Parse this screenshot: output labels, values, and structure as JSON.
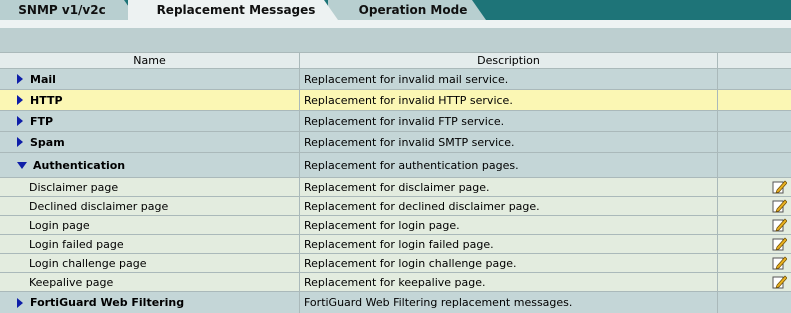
{
  "tabs": [
    {
      "label": "SNMP v1/v2c"
    },
    {
      "label": "Replacement Messages"
    },
    {
      "label": "Operation Mode"
    }
  ],
  "table": {
    "headers": {
      "name": "Name",
      "description": "Description"
    },
    "rows": [
      {
        "name": "Mail",
        "description": "Replacement for invalid mail service."
      },
      {
        "name": "HTTP",
        "description": "Replacement for invalid HTTP service."
      },
      {
        "name": "FTP",
        "description": "Replacement for invalid FTP service."
      },
      {
        "name": "Spam",
        "description": "Replacement for invalid SMTP service."
      },
      {
        "name": "Authentication",
        "description": "Replacement for authentication pages."
      },
      {
        "name": "Disclaimer page",
        "description": "Replacement for disclaimer page."
      },
      {
        "name": "Declined disclaimer page",
        "description": "Replacement for declined disclaimer page."
      },
      {
        "name": "Login page",
        "description": "Replacement for login page."
      },
      {
        "name": "Login failed page",
        "description": "Replacement for login failed page."
      },
      {
        "name": "Login challenge page",
        "description": "Replacement for login challenge page."
      },
      {
        "name": "Keepalive page",
        "description": "Replacement for keepalive page."
      },
      {
        "name": "FortiGuard Web Filtering",
        "description": "FortiGuard Web Filtering replacement messages."
      }
    ]
  },
  "icons": {
    "expand": "triangle-right-icon",
    "collapse": "triangle-down-icon",
    "edit": "edit-pencil-icon"
  }
}
